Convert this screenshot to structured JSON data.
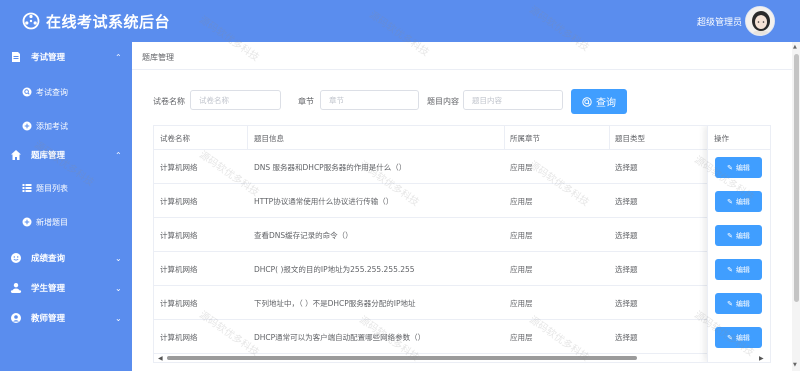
{
  "header": {
    "title": "在线考试系统后台",
    "user_name": "超级管理员"
  },
  "sidebar": {
    "menus": [
      {
        "label": "考试管理",
        "icon": "document-icon",
        "expanded": true,
        "children": [
          {
            "label": "考试查询",
            "icon": "search-circle-icon"
          },
          {
            "label": "添加考试",
            "icon": "plus-circle-icon"
          }
        ]
      },
      {
        "label": "题库管理",
        "icon": "home-icon",
        "expanded": true,
        "children": [
          {
            "label": "题目列表",
            "icon": "list-icon"
          },
          {
            "label": "新增题目",
            "icon": "plus-circle-icon"
          }
        ]
      },
      {
        "label": "成绩查询",
        "icon": "smile-icon",
        "expanded": false
      },
      {
        "label": "学生管理",
        "icon": "user-group-icon",
        "expanded": false
      },
      {
        "label": "教师管理",
        "icon": "teacher-icon",
        "expanded": false
      }
    ]
  },
  "breadcrumb": "题库管理",
  "filters": {
    "paper_name_label": "试卷名称",
    "paper_name_placeholder": "试卷名称",
    "chapter_label": "章节",
    "chapter_placeholder": "章节",
    "content_label": "题目内容",
    "content_placeholder": "题目内容",
    "query_label": "查询"
  },
  "table": {
    "columns": [
      "试卷名称",
      "题目信息",
      "所属章节",
      "题目类型",
      "操作"
    ],
    "edit_label": "编辑",
    "rows": [
      {
        "paper": "计算机网络",
        "question": "DNS 服务器和DHCP服务器的作用是什么（）",
        "chapter": "应用层",
        "type": "选择题"
      },
      {
        "paper": "计算机网络",
        "question": "HTTP协议通常使用什么协议进行传输（）",
        "chapter": "应用层",
        "type": "选择题"
      },
      {
        "paper": "计算机网络",
        "question": "查看DNS缓存记录的命令（）",
        "chapter": "应用层",
        "type": "选择题"
      },
      {
        "paper": "计算机网络",
        "question": "DHCP( )报文的目的IP地址为255.255.255.255",
        "chapter": "应用层",
        "type": "选择题"
      },
      {
        "paper": "计算机网络",
        "question": "下列地址中，（ ）不是DHCP服务器分配的IP地址",
        "chapter": "应用层",
        "type": "选择题"
      },
      {
        "paper": "计算机网络",
        "question": "DHCP通常可以为客户端自动配置哪些网络参数（）",
        "chapter": "应用层",
        "type": "选择题"
      }
    ]
  },
  "watermark_text": "源码软优多科技",
  "colors": {
    "brand": "#5a8dee",
    "primary_button": "#409eff"
  }
}
